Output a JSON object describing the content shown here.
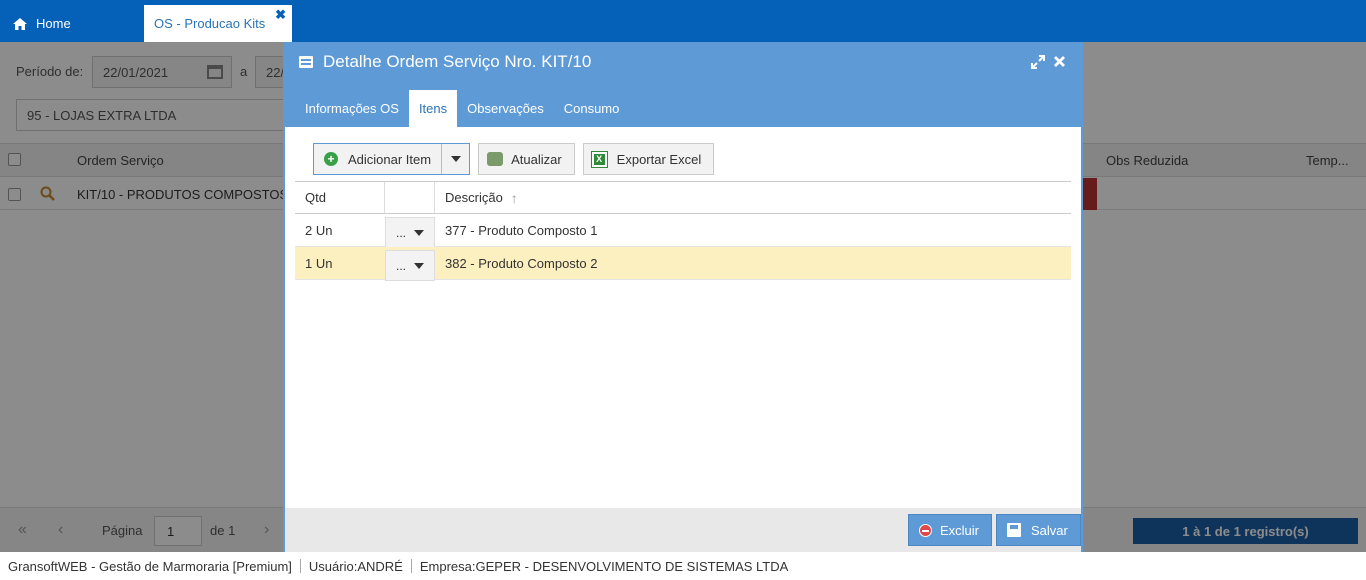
{
  "topbar": {
    "home_label": "Home",
    "active_tab_label": "OS - Producao Kits",
    "close_glyph": "✖"
  },
  "background": {
    "periodo_label": "Período de:",
    "date_from": "22/01/2021",
    "a_label": "a",
    "date_to": "22/",
    "client": "95 - LOJAS EXTRA LTDA",
    "columns": {
      "ordem_servico": "Ordem Serviço",
      "obs_reduzida": "Obs Reduzida",
      "temp": "Temp..."
    },
    "row": {
      "ordem_servico": "KIT/10 - PRODUTOS COMPOSTOS"
    },
    "pager": {
      "pagina_label": "Página",
      "page_value": "1",
      "de_label": "de 1",
      "registros": "1 à 1 de 1 registro(s)"
    }
  },
  "modal": {
    "title": "Detalhe Ordem Serviço Nro. KIT/10",
    "tabs": [
      {
        "label": "Informações OS"
      },
      {
        "label": "Itens"
      },
      {
        "label": "Observações"
      },
      {
        "label": "Consumo"
      }
    ],
    "toolbar": {
      "add_label": "Adicionar Item",
      "refresh_label": "Atualizar",
      "excel_label": "Exportar Excel"
    },
    "table": {
      "headers": {
        "qtd": "Qtd",
        "descricao": "Descrição"
      },
      "rows": [
        {
          "qtd": "2 Un",
          "action": "...",
          "descricao": "377 - Produto Composto 1"
        },
        {
          "qtd": "1 Un",
          "action": "...",
          "descricao": "382 - Produto Composto 2"
        }
      ]
    },
    "footer": {
      "delete_label": "Excluir",
      "save_label": "Salvar"
    }
  },
  "statusbar": {
    "app": "GransoftWEB - Gestão de Marmoraria [Premium]",
    "user_label": "Usuário:",
    "user": "ANDRÉ",
    "company_label": "Empresa:",
    "company": "GEPER - DESENVOLVIMENTO DE SISTEMAS LTDA"
  },
  "colors": {
    "topbar": "#0560b8",
    "modal_header": "#5d9ad6",
    "selected_row": "#fdf0c0"
  }
}
